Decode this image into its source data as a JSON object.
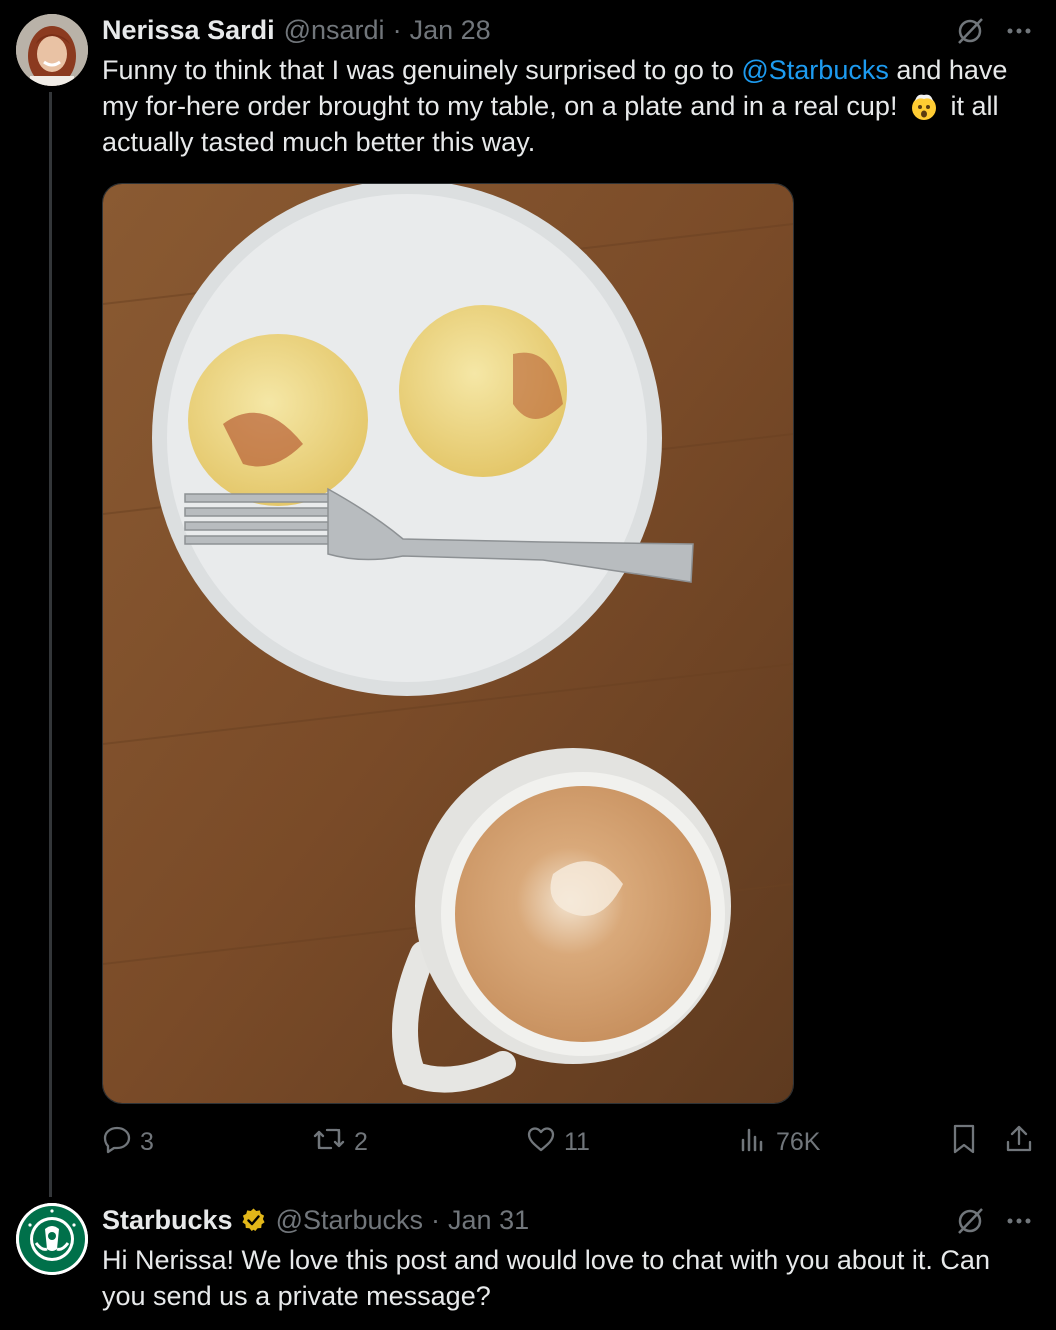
{
  "tweet": {
    "author_name": "Nerissa Sardi",
    "author_handle": "@nsardi",
    "separator": "·",
    "date": "Jan 28",
    "text_part1": "Funny to think that I was genuinely surprised to go to ",
    "mention": "@Starbucks",
    "text_part2": " and have my for-here order brought to my table, on a plate and in a real cup! ",
    "text_part3": " it all actually tasted much better this way.",
    "emoji_name": "exploding-head-emoji",
    "stats": {
      "replies": "3",
      "reposts": "2",
      "likes": "11",
      "views": "76K"
    },
    "icons": {
      "grok": "grok-icon",
      "more": "more-icon",
      "reply": "reply-icon",
      "repost": "repost-icon",
      "like": "heart-icon",
      "views": "views-icon",
      "bookmark": "bookmark-icon",
      "share": "share-icon"
    }
  },
  "reply": {
    "author_name": "Starbucks",
    "author_handle": "@Starbucks",
    "separator": "·",
    "date": "Jan 31",
    "text": "Hi Nerissa! We love this post and would love to chat with you about it. Can you send us a private message?",
    "verified_color": "#e2b719"
  },
  "colors": {
    "background": "#000000",
    "text": "#e7e9ea",
    "muted": "#71767b",
    "link": "#1d9bf0",
    "starbucks_green": "#00704a"
  }
}
